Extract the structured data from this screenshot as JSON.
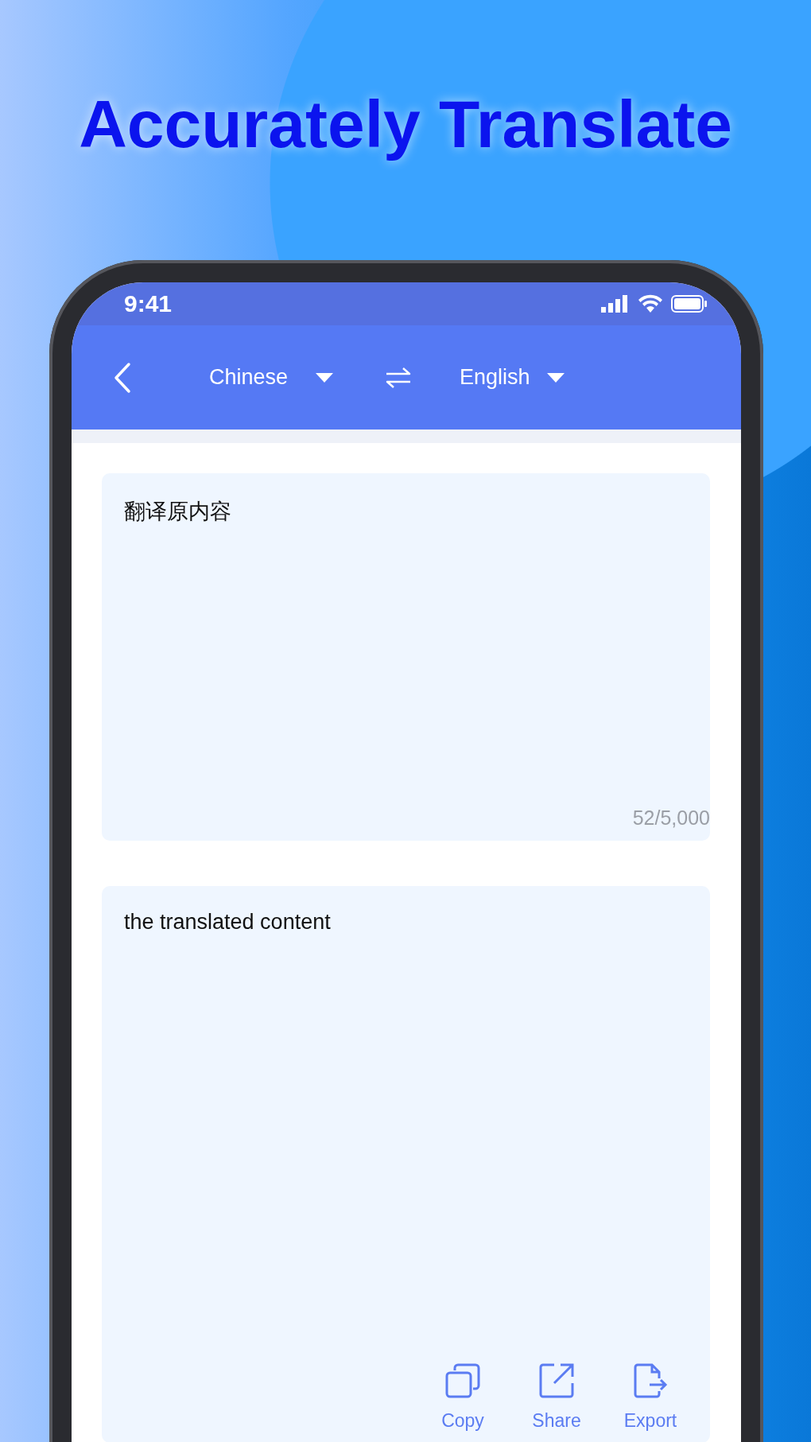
{
  "title": "Accurately Translate",
  "status_bar": {
    "time": "9:41"
  },
  "header": {
    "source_language": "Chinese",
    "target_language": "English"
  },
  "source": {
    "text": "翻译原内容",
    "counter": "52/5,000"
  },
  "result": {
    "text": "the translated content",
    "actions": [
      {
        "kind": "copy",
        "label": "Copy"
      },
      {
        "kind": "share",
        "label": "Share"
      },
      {
        "kind": "export",
        "label": "Export"
      }
    ]
  }
}
